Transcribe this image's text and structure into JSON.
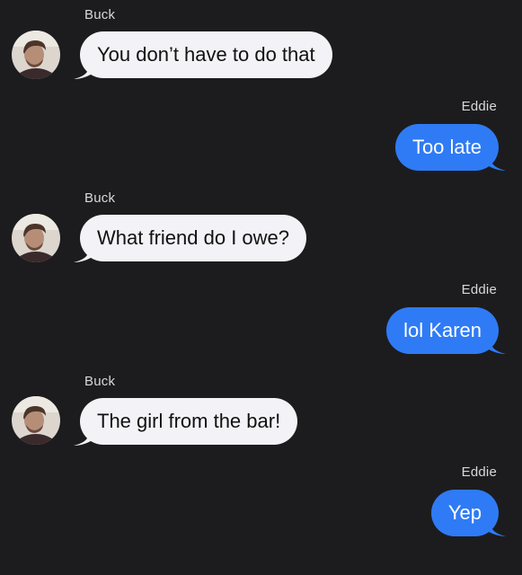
{
  "colors": {
    "background": "#1c1c1e",
    "incoming_bubble": "#f2f2f7",
    "outgoing_bubble": "#2f7bf5",
    "incoming_text": "#111111",
    "outgoing_text": "#ffffff",
    "sender_text": "#d8d8dc"
  },
  "conversation": {
    "messages": [
      {
        "sender": "Buck",
        "direction": "incoming",
        "text": "You don’t have to do that",
        "avatar_icon": "person-photo-avatar"
      },
      {
        "sender": "Eddie",
        "direction": "outgoing",
        "text": "Too late"
      },
      {
        "sender": "Buck",
        "direction": "incoming",
        "text": "What friend do I owe?",
        "avatar_icon": "person-photo-avatar"
      },
      {
        "sender": "Eddie",
        "direction": "outgoing",
        "text": "lol Karen"
      },
      {
        "sender": "Buck",
        "direction": "incoming",
        "text": "The girl from the bar!",
        "avatar_icon": "person-photo-avatar"
      },
      {
        "sender": "Eddie",
        "direction": "outgoing",
        "text": "Yep"
      }
    ]
  }
}
